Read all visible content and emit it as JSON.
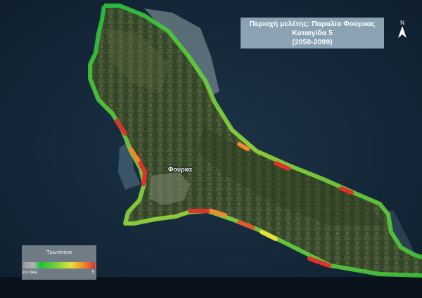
{
  "map": {
    "title_lines": [
      "Περιοχή μελέτης: Παραλία Φούρκας",
      "Καταιγίδα 5",
      "(2050-2099)"
    ],
    "north_arrow": {
      "label": "N",
      "icon": "north-arrow-icon"
    },
    "place_labels": [
      {
        "name": "Φούρκα"
      }
    ],
    "legend": {
      "title": "Τρωτότητα",
      "min_label": "no data",
      "max_label": "5",
      "ramp_colors": [
        "#9a9a9a",
        "#1fbf3a",
        "#e8e23a",
        "#f08a2a",
        "#e0312a"
      ]
    },
    "colors": {
      "sea": "#16283a",
      "land": "#3c4e30",
      "low_vulnerability": "#1fbf3a",
      "high_vulnerability": "#e0312a"
    }
  }
}
